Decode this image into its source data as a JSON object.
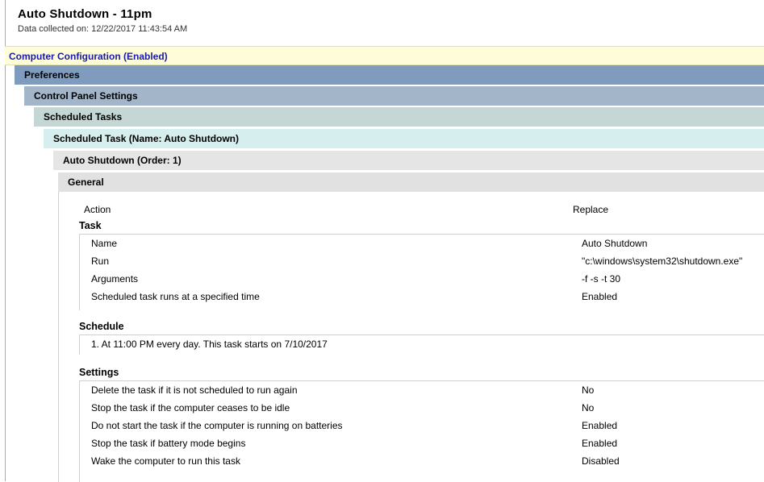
{
  "report": {
    "title": "Auto Shutdown - 11pm",
    "collected": "Data collected on: 12/22/2017 11:43:54 AM"
  },
  "sections": {
    "computer_config": "Computer Configuration (Enabled)",
    "preferences": "Preferences",
    "control_panel": "Control Panel Settings",
    "scheduled_tasks": "Scheduled Tasks",
    "scheduled_task": "Scheduled Task (Name: Auto Shutdown)",
    "auto_shutdown": "Auto Shutdown (Order: 1)",
    "general": "General"
  },
  "general": {
    "action_label": "Action",
    "action_value": "Replace",
    "task_heading": "Task",
    "task_rows": [
      {
        "label": "Name",
        "value": "Auto Shutdown"
      },
      {
        "label": "Run",
        "value": "\"c:\\windows\\system32\\shutdown.exe\""
      },
      {
        "label": "Arguments",
        "value": "-f -s -t 30"
      },
      {
        "label": "Scheduled task runs at a specified time",
        "value": "Enabled"
      }
    ],
    "schedule_heading": "Schedule",
    "schedule_text": "1. At 11:00 PM every day. This task starts on 7/10/2017",
    "settings_heading": "Settings",
    "settings_rows": [
      {
        "label": "Delete the task if it is not scheduled to run again",
        "value": "No"
      },
      {
        "label": "Stop the task if the computer ceases to be idle",
        "value": "No"
      },
      {
        "label": "Do not start the task if the computer is running on batteries",
        "value": "Enabled"
      },
      {
        "label": "Stop the task if battery mode begins",
        "value": "Enabled"
      },
      {
        "label": "Wake the computer to run this task",
        "value": "Disabled"
      }
    ]
  }
}
